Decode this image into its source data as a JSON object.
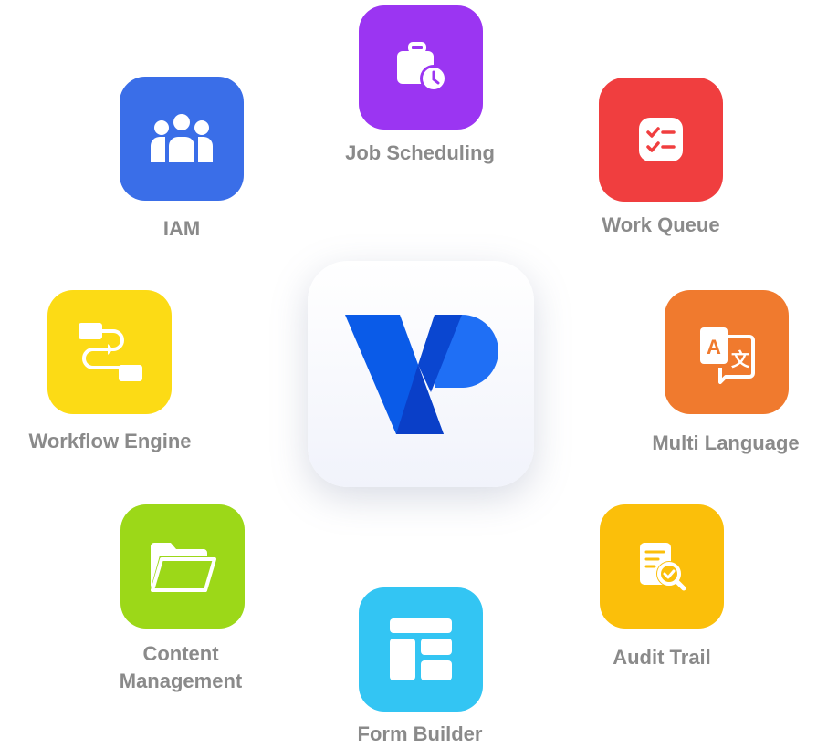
{
  "center": {
    "logo": "vp-logo",
    "colors": [
      "#0a5be8",
      "#1f6ff5",
      "#0a46d0"
    ]
  },
  "modules": [
    {
      "label": "Job Scheduling",
      "icon": "briefcase-clock-icon",
      "color": "#9b35f2"
    },
    {
      "label": "Work Queue",
      "icon": "checklist-icon",
      "color": "#f03e3f"
    },
    {
      "label": "Multi Language",
      "icon": "translate-icon",
      "color": "#f07a2e"
    },
    {
      "label": "Audit Trail",
      "icon": "document-search-icon",
      "color": "#fbbf0a"
    },
    {
      "label": "Form Builder",
      "icon": "layout-icon",
      "color": "#33c5f3"
    },
    {
      "label_line1": "Content",
      "label_line2": "Management",
      "icon": "folder-icon",
      "color": "#9cd818"
    },
    {
      "label": "Workflow Engine",
      "icon": "workflow-icon",
      "color": "#fcdb15"
    },
    {
      "label": "IAM",
      "icon": "users-icon",
      "color": "#3a6ee8"
    }
  ]
}
